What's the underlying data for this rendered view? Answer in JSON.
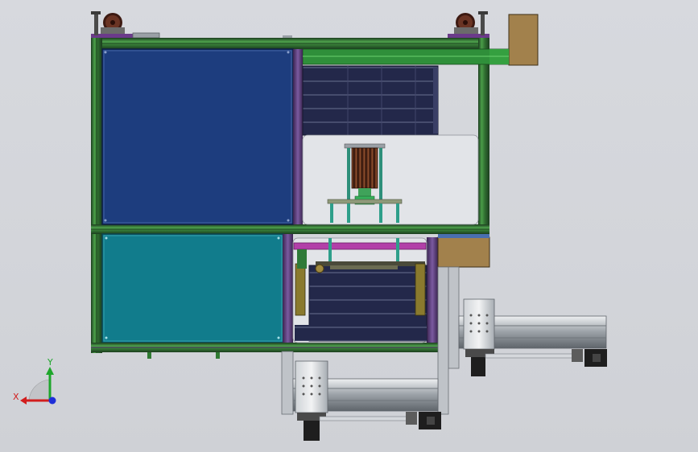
{
  "view": {
    "background_color": "#d4d6db"
  },
  "triad": {
    "x_label": "X",
    "y_label": "Y",
    "x_color": "#d21d1d",
    "y_color": "#1ea62b",
    "z_color": "#1e2fd8"
  },
  "colors": {
    "frame_green": "#3c8a3c",
    "frame_dark": "#1f3f20",
    "panel_top": "#1d3d7e",
    "panel_bottom": "#117c8c",
    "frame_purple": "#5a3c7a",
    "tray_dark": "#23284a",
    "box_tan": "#a2814c",
    "caster_brown": "#5a2a1e",
    "rail_grey": "#9aa0a6"
  }
}
